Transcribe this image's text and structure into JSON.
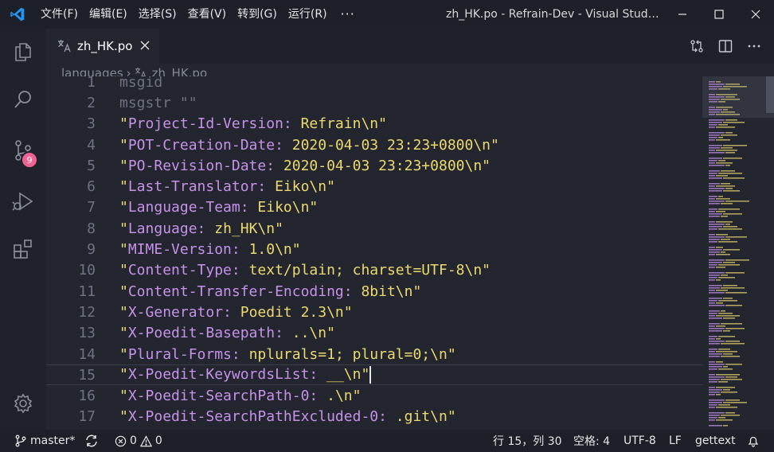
{
  "window": {
    "title": "zh_HK.po - Refrain-Dev - Visual Stud…",
    "menu": [
      "文件(F)",
      "编辑(E)",
      "选择(S)",
      "查看(V)",
      "转到(G)",
      "运行(R)"
    ],
    "more": "···"
  },
  "activity": {
    "scm_badge": "9"
  },
  "tab": {
    "label": "zh_HK.po"
  },
  "breadcrumb": {
    "folder": "languages",
    "file": "zh_HK.po"
  },
  "editor": {
    "lines": [
      {
        "n": "1",
        "prefix": "msgid",
        "key": "",
        "value": "",
        "partial": true
      },
      {
        "n": "2",
        "prefix": "msgstr",
        "key": "",
        "value": "",
        "plain": "msgstr \"\""
      },
      {
        "n": "3",
        "key": "Project-Id-Version:",
        "value": " Refrain\\n"
      },
      {
        "n": "4",
        "key": "POT-Creation-Date:",
        "value": " 2020-04-03 23:23+0800\\n"
      },
      {
        "n": "5",
        "key": "PO-Revision-Date:",
        "value": " 2020-04-03 23:23+0800\\n"
      },
      {
        "n": "6",
        "key": "Last-Translator:",
        "value": " Eiko\\n"
      },
      {
        "n": "7",
        "key": "Language-Team:",
        "value": " Eiko\\n"
      },
      {
        "n": "8",
        "key": "Language:",
        "value": " zh_HK\\n"
      },
      {
        "n": "9",
        "key": "MIME-Version:",
        "value": " 1.0\\n"
      },
      {
        "n": "10",
        "key": "Content-Type:",
        "value": " text/plain; charset=UTF-8\\n"
      },
      {
        "n": "11",
        "key": "Content-Transfer-Encoding:",
        "value": " 8bit\\n"
      },
      {
        "n": "12",
        "key": "X-Generator:",
        "value": " Poedit 2.3\\n"
      },
      {
        "n": "13",
        "key": "X-Poedit-Basepath:",
        "value": " ..\\n"
      },
      {
        "n": "14",
        "key": "Plural-Forms:",
        "value": " nplurals=1; plural=0;\\n"
      },
      {
        "n": "15",
        "key": "X-Poedit-KeywordsList:",
        "value": " __\\n",
        "current": true
      },
      {
        "n": "16",
        "key": "X-Poedit-SearchPath-0:",
        "value": " .\\n"
      },
      {
        "n": "17",
        "key": "X-Poedit-SearchPathExcluded-0:",
        "value": " .git\\n"
      }
    ]
  },
  "status": {
    "branch": "master*",
    "errors": "0",
    "warnings": "0",
    "position": "行 15，列 30",
    "spaces": "空格: 4",
    "encoding": "UTF-8",
    "eol": "LF",
    "language": "gettext"
  },
  "colors": {
    "key": "#c792ea",
    "value": "#ecd96f",
    "badge": "#f06292",
    "accent": "#1e88e5"
  }
}
